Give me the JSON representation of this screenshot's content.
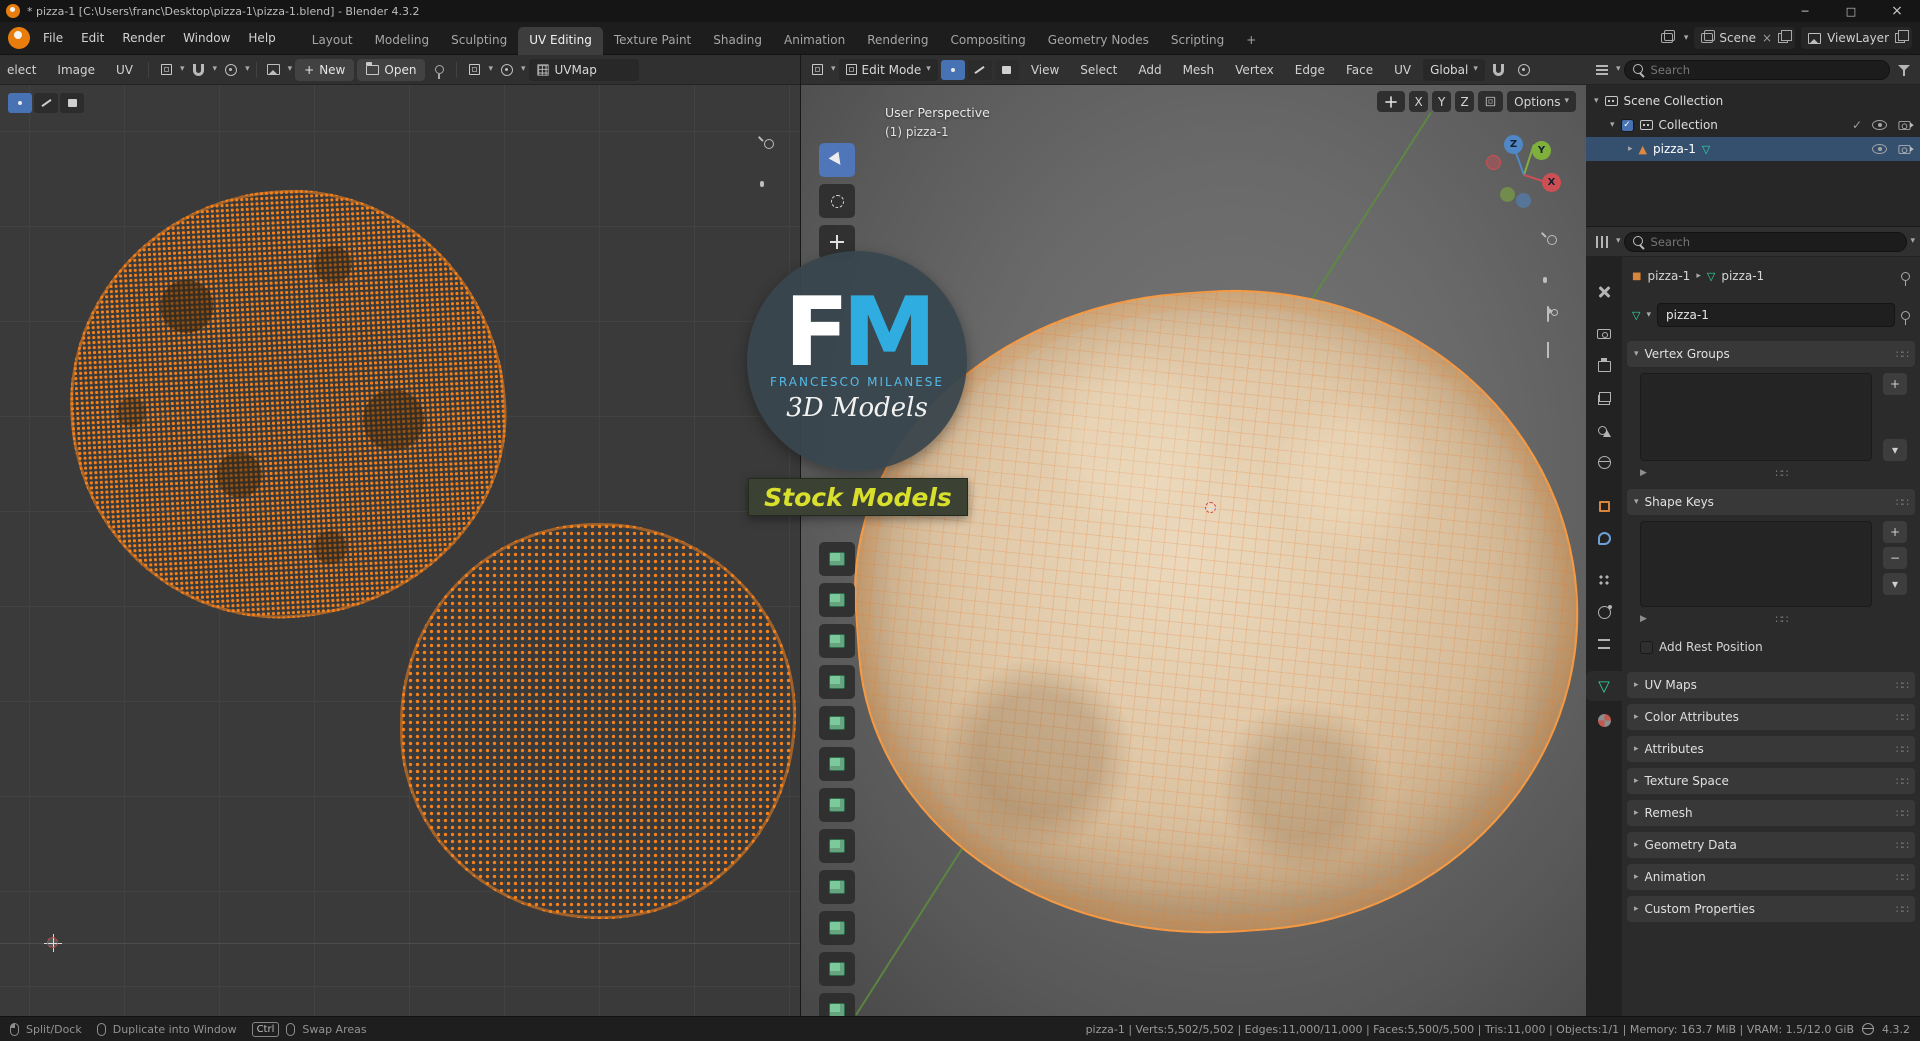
{
  "icons": {
    "minimize": "─",
    "maximize": "□",
    "close": "×",
    "chevron_down": "▾",
    "chevron_right": "▸",
    "plus": "+",
    "minus": "−",
    "play": "▶",
    "check": "✓",
    "drag_handle": "∷∷",
    "mesh_data": "▽",
    "mesh_object": "▲",
    "object_square": "■"
  },
  "titlebar": {
    "title": "* pizza-1 [C:\\Users\\franc\\Desktop\\pizza-1\\pizza-1.blend] - Blender 4.3.2"
  },
  "topbar": {
    "menus": [
      "File",
      "Edit",
      "Render",
      "Window",
      "Help"
    ],
    "workspaces": [
      "Layout",
      "Modeling",
      "Sculpting",
      "UV Editing",
      "Texture Paint",
      "Shading",
      "Animation",
      "Rendering",
      "Compositing",
      "Geometry Nodes",
      "Scripting"
    ],
    "add_workspace": "+",
    "scene_name": "Scene",
    "viewlayer_name": "ViewLayer"
  },
  "uv_editor": {
    "menus": [
      "elect",
      "Image",
      "UV"
    ],
    "new_button": "New",
    "open_button": "Open",
    "uvmap_name": "UVMap"
  },
  "viewport": {
    "mode": "Edit Mode",
    "menus": [
      "View",
      "Select",
      "Add",
      "Mesh",
      "Vertex",
      "Edge",
      "Face",
      "UV"
    ],
    "orientation": "Global",
    "axes": [
      "X",
      "Y",
      "Z"
    ],
    "options_label": "Options",
    "overlay_perspective": "User Perspective",
    "overlay_object": "(1) pizza-1"
  },
  "watermark": {
    "initial_f": "F",
    "initial_m": "M",
    "author": "FRANCESCO MILANESE",
    "subtitle": "3D Models",
    "badge": "Stock Models"
  },
  "outliner": {
    "search_placeholder": "Search",
    "scene_collection": "Scene Collection",
    "collection": "Collection",
    "object_name": "pizza-1"
  },
  "properties": {
    "search_placeholder": "Search",
    "breadcrumb_object": "pizza-1",
    "breadcrumb_data": "pizza-1",
    "name_value": "pizza-1",
    "vertex_groups_title": "Vertex Groups",
    "shape_keys_title": "Shape Keys",
    "add_rest_position": "Add Rest Position",
    "collapsed_panels": [
      "UV Maps",
      "Color Attributes",
      "Attributes",
      "Texture Space",
      "Remesh",
      "Geometry Data",
      "Animation",
      "Custom Properties"
    ]
  },
  "statusbar": {
    "hint_split": "Split/Dock",
    "hint_duplicate": "Duplicate into Window",
    "key_ctrl": "Ctrl",
    "hint_swap": "Swap Areas",
    "stats_line": "pizza-1 | Verts:5,502/5,502 | Edges:11,000/11,000 | Faces:5,500/5,500 | Tris:11,000 | Objects:1/1 | Memory: 163.7 MiB | VRAM: 1.5/12.0 GiB",
    "version": "4.3.2"
  }
}
